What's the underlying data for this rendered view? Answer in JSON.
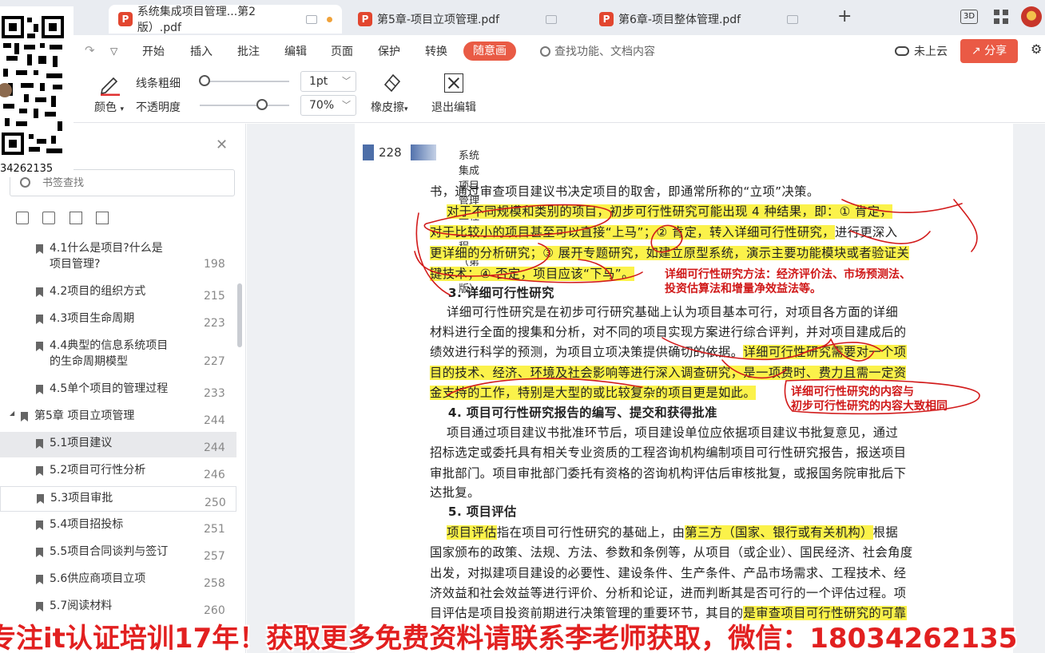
{
  "tabs": [
    {
      "label": "系统集成项目管理...第2版）.pdf",
      "active": true
    },
    {
      "label": "第5章-项目立项管理.pdf",
      "active": false
    },
    {
      "label": "第6章-项目整体管理.pdf",
      "active": false
    }
  ],
  "window": {
    "new_tab": "+",
    "view_mode_label": "3D"
  },
  "menu": {
    "items": [
      "开始",
      "插入",
      "批注",
      "编辑",
      "页面",
      "保护",
      "转换"
    ],
    "special": "随意画",
    "search_placeholder": "查找功能、文档内容",
    "cloud": "未上云",
    "share": "分享"
  },
  "ribbon": {
    "color_label": "颜色",
    "line_width_label": "线条粗细",
    "opacity_label": "不透明度",
    "line_width_value": "1pt",
    "opacity_value": "70%",
    "eraser_label": "橡皮擦",
    "exit_label": "退出编辑",
    "line_width_level": 0.0,
    "opacity_level": 0.7
  },
  "qr": {
    "text": "34262135"
  },
  "sidebar": {
    "search_placeholder": "书签查找",
    "bookmarks": [
      {
        "label": "4.1什么是项目?什么是\n项目管理?",
        "page": "198",
        "level": 2
      },
      {
        "label": "4.2项目的组织方式",
        "page": "215",
        "level": 2
      },
      {
        "label": "4.3项目生命周期",
        "page": "223",
        "level": 2
      },
      {
        "label": "4.4典型的信息系统项目\n的生命周期模型",
        "page": "227",
        "level": 2
      },
      {
        "label": "4.5单个项目的管理过程",
        "page": "233",
        "level": 2
      },
      {
        "label": "第5章 项目立项管理",
        "page": "244",
        "level": 1
      },
      {
        "label": "5.1项目建议",
        "page": "244",
        "level": 2
      },
      {
        "label": "5.2项目可行性分析",
        "page": "246",
        "level": 2
      },
      {
        "label": "5.3项目审批",
        "page": "250",
        "level": 2
      },
      {
        "label": "5.4项目招投标",
        "page": "251",
        "level": 2
      },
      {
        "label": "5.5项目合同谈判与签订",
        "page": "257",
        "level": 2
      },
      {
        "label": "5.6供应商项目立项",
        "page": "258",
        "level": 2
      },
      {
        "label": "5.7阅读材料",
        "page": "260",
        "level": 2
      }
    ]
  },
  "page": {
    "number": "228",
    "header_title": "系统集成项目管理工程师教程（第 2 版）",
    "lines": [
      {
        "segs": [
          {
            "t": "书，通过审查项目建议书决定项目的取舍，即通常所称的“立项”决策。"
          }
        ]
      },
      {
        "segs": [
          {
            "t": "    "
          },
          {
            "t": "对于不同规模和类别的项目，初步可行性研究可能出现 4 种结果，即：① 肯定，",
            "hl": true
          }
        ]
      },
      {
        "segs": [
          {
            "t": "对于比较小的项目甚至可以直接“上马”；② 肯定，转入详细可行性研究，",
            "hl": true
          },
          {
            "t": "进行更深入"
          }
        ]
      },
      {
        "segs": [
          {
            "t": "更详细的分析研究；③ 展开专题研究，如建立原型系统，演示主要功能模块或者验证关",
            "hl": true
          }
        ]
      },
      {
        "segs": [
          {
            "t": "键技术；④ 否定，项目应该“下马”。",
            "hl": true
          }
        ]
      },
      {
        "segs": [
          {
            "t": "    3. 详细可行性研究",
            "b": true
          }
        ]
      },
      {
        "segs": [
          {
            "t": "    详细可行性研究是在初步可行研究基础上认为项目基本可行，对项目各方面的详细"
          }
        ]
      },
      {
        "segs": [
          {
            "t": "材料进行全面的搜集和分析，对不同的项目实现方案进行综合评判，并对项目建成后的"
          }
        ]
      },
      {
        "segs": [
          {
            "t": "绩效进行科学的预测，为项目立项决策提供确切的依据。"
          },
          {
            "t": "详细可行性研究需要对一个项",
            "hl": true
          }
        ]
      },
      {
        "segs": [
          {
            "t": "目的技术、经济、环境及社会影响等进行深入调查研究，是一项费时、费力且需一定资",
            "hl": true
          }
        ]
      },
      {
        "segs": [
          {
            "t": "金支持的工作，特别是大型的或比较复杂的项目更是如此。",
            "hl": true
          }
        ]
      },
      {
        "segs": [
          {
            "t": "    4. 项目可行性研究报告的编写、提交和获得批准",
            "b": true
          }
        ]
      },
      {
        "segs": [
          {
            "t": "    项目通过项目建议书批准环节后，项目建设单位应依据项目建议书批复意见，通过"
          }
        ]
      },
      {
        "segs": [
          {
            "t": "招标选定或委托具有相关专业资质的工程咨询机构编制项目可行性研究报告，报送项目"
          }
        ]
      },
      {
        "segs": [
          {
            "t": "审批部门。项目审批部门委托有资格的咨询机构评估后审核批复，或报国务院审批后下"
          }
        ]
      },
      {
        "segs": [
          {
            "t": "达批复。"
          }
        ]
      },
      {
        "segs": [
          {
            "t": "    5. 项目评估",
            "b": true
          }
        ]
      },
      {
        "segs": [
          {
            "t": "    "
          },
          {
            "t": "项目评估",
            "hl": true
          },
          {
            "t": "指在项目可行性研究的基础上，由"
          },
          {
            "t": "第三方（国家、银行或有关机构）",
            "hl": true
          },
          {
            "t": "根据"
          }
        ]
      },
      {
        "segs": [
          {
            "t": "国家颁布的政策、法规、方法、参数和条例等，从项目（或企业）、国民经济、社会角度"
          }
        ]
      },
      {
        "segs": [
          {
            "t": "出发，对拟建项目建设的必要性、建设条件、生产条件、产品市场需求、工程技术、经"
          }
        ]
      },
      {
        "segs": [
          {
            "t": "济效益和社会效益等进行评价、分析和论证，进而判断其是否可行的一个评估过程。项"
          }
        ]
      },
      {
        "segs": [
          {
            "t": "目评估是项目投资前期进行决策管理的重要环节，其目的"
          },
          {
            "t": "是审查项目可行性研究的可靠",
            "hl": true
          }
        ]
      }
    ],
    "notes": [
      "详细可行性研究方法：经济评价法、市场预测法、\n投资估算法和增量净效益法等。",
      "详细可行性研究的内容与\n初步可行性研究的内容大致相同"
    ]
  },
  "banner": "专注it认证培训17年！获取更多免费资料请联系李老师获取，微信：18034262135"
}
